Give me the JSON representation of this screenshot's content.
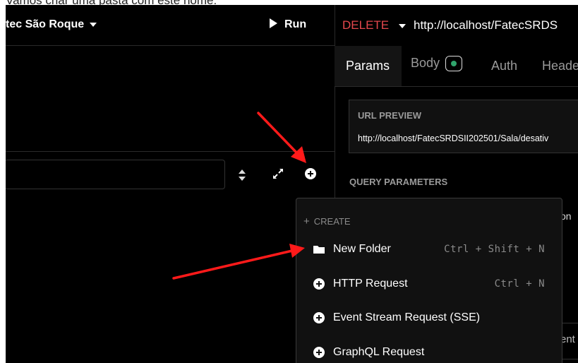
{
  "caption": "Vamos criar uma pasta com este nome:",
  "sidebar": {
    "workspace_title": "tec São Roque",
    "run_label": "Run"
  },
  "request": {
    "method": "DELETE",
    "url": "http://localhost/FatecSRDS",
    "tabs": [
      {
        "label": "Params"
      },
      {
        "label": "Body"
      },
      {
        "label": "Auth"
      },
      {
        "label": "Heade"
      }
    ],
    "url_preview_label": "URL PREVIEW",
    "url_preview": "http://localhost/FatecSRDSII202501/Sala/desativ",
    "query_params_label": "QUERY PARAMETERS",
    "partial_text_1": "on",
    "partial_text_2": "ent"
  },
  "create_menu": {
    "header": "CREATE",
    "items": [
      {
        "label": "New Folder",
        "shortcut": "Ctrl + Shift + N",
        "icon": "folder-icon"
      },
      {
        "label": "HTTP Request",
        "shortcut": "Ctrl + N",
        "icon": "plus-circle-icon"
      },
      {
        "label": "Event Stream Request (SSE)",
        "shortcut": "",
        "icon": "plus-circle-icon"
      },
      {
        "label": "GraphQL Request",
        "shortcut": "",
        "icon": "plus-circle-icon"
      }
    ]
  },
  "colors": {
    "method_delete": "#e5484d",
    "badge_green": "#30a46c",
    "annotation_arrow": "#ff1a1a"
  }
}
